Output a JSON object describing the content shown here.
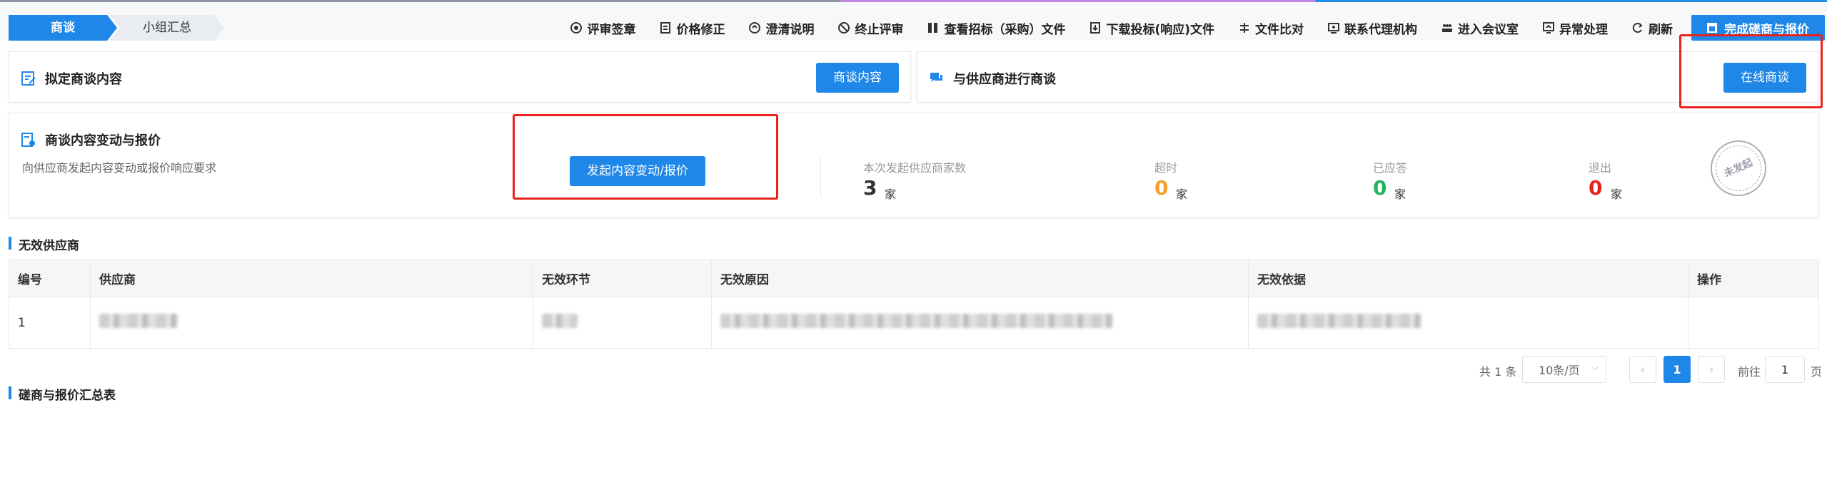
{
  "steps": [
    "商谈",
    "小组汇总"
  ],
  "toolbar": {
    "items": [
      {
        "icon": "seal-icon",
        "label": "评审签章"
      },
      {
        "icon": "price-edit-icon",
        "label": "价格修正"
      },
      {
        "icon": "clarify-icon",
        "label": "澄清说明"
      },
      {
        "icon": "stop-icon",
        "label": "终止评审"
      },
      {
        "icon": "bid-file-icon",
        "label": "查看招标（采购）文件"
      },
      {
        "icon": "download-icon",
        "label": "下载投标(响应)文件"
      },
      {
        "icon": "compare-icon",
        "label": "文件比对"
      },
      {
        "icon": "agent-icon",
        "label": "联系代理机构"
      },
      {
        "icon": "meeting-icon",
        "label": "进入会议室"
      },
      {
        "icon": "exception-icon",
        "label": "异常处理"
      },
      {
        "icon": "refresh-icon",
        "label": "刷新"
      }
    ],
    "finish_label": "完成磋商与报价"
  },
  "draft_card": {
    "title": "拟定商谈内容",
    "button": "商谈内容"
  },
  "online_card": {
    "title": "与供应商进行商谈",
    "button": "在线商谈"
  },
  "change_card": {
    "title": "商谈内容变动与报价",
    "desc": "向供应商发起内容变动或报价响应要求",
    "button": "发起内容变动/报价",
    "stats": [
      {
        "label": "本次发起供应商家数",
        "value": "3",
        "unit": "家",
        "color": "#333333"
      },
      {
        "label": "超时",
        "value": "0",
        "unit": "家",
        "color": "#f5a02b"
      },
      {
        "label": "已应答",
        "value": "0",
        "unit": "家",
        "color": "#1fb35c"
      },
      {
        "label": "退出",
        "value": "0",
        "unit": "家",
        "color": "#e8221c"
      }
    ],
    "stamp": "未发起"
  },
  "invalid_section": {
    "title": "无效供应商",
    "columns": [
      "编号",
      "供应商",
      "无效环节",
      "无效原因",
      "无效依据",
      "操作"
    ],
    "rows": [
      {
        "no": "1"
      }
    ]
  },
  "pagination": {
    "total": "共 1 条",
    "page_size": "10条/页",
    "current_page": "1",
    "goto_prefix": "前往",
    "goto_value": "1",
    "goto_suffix": "页"
  },
  "summary_section": {
    "title": "磋商与报价汇总表"
  },
  "colors": {
    "primary": "#1e87e8",
    "highlight": "#e8221c"
  }
}
